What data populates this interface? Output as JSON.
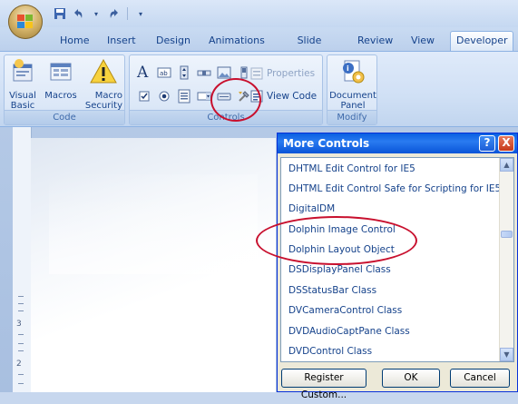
{
  "quick_access": {
    "save_icon": "save-icon",
    "undo_icon": "undo-icon",
    "redo_icon": "redo-icon",
    "customize_icon": "dropdown-arrow-icon"
  },
  "tabs": [
    {
      "label": "Home"
    },
    {
      "label": "Insert"
    },
    {
      "label": "Design"
    },
    {
      "label": "Animations"
    },
    {
      "label": "Slide Show"
    },
    {
      "label": "Review"
    },
    {
      "label": "View"
    },
    {
      "label": "Developer"
    }
  ],
  "active_tab": "Developer",
  "ribbon": {
    "code_group": {
      "label": "Code",
      "visual_basic": "Visual\nBasic",
      "macros": "Macros",
      "macro_security": "Macro\nSecurity"
    },
    "controls_group": {
      "label": "Controls",
      "properties": "Properties",
      "view_code": "View Code"
    },
    "modify_group": {
      "label": "Modify",
      "document_panel": "Document\nPanel"
    }
  },
  "dialog": {
    "title": "More Controls",
    "help_label": "?",
    "close_label": "X",
    "items": [
      {
        "label": "DHTML Edit Control for IE5"
      },
      {
        "label": "DHTML Edit Control Safe for Scripting for IE5"
      },
      {
        "label": "DigitalDM"
      },
      {
        "label": "Dolphin Image Control"
      },
      {
        "label": "Dolphin Layout Object"
      },
      {
        "label": "DSDisplayPanel Class"
      },
      {
        "label": "DSStatusBar Class"
      },
      {
        "label": "DVCameraControl Class"
      },
      {
        "label": "DVDAudioCaptPane Class"
      },
      {
        "label": "DVDControl Class"
      }
    ],
    "buttons": {
      "register": "Register Custom...",
      "ok": "OK",
      "cancel": "Cancel"
    }
  },
  "ruler_numbers": [
    "3",
    "2"
  ],
  "colors": {
    "annotation": "#c8102e",
    "dialog_title": "#0a5fe1",
    "ribbon_text": "#15428b"
  }
}
